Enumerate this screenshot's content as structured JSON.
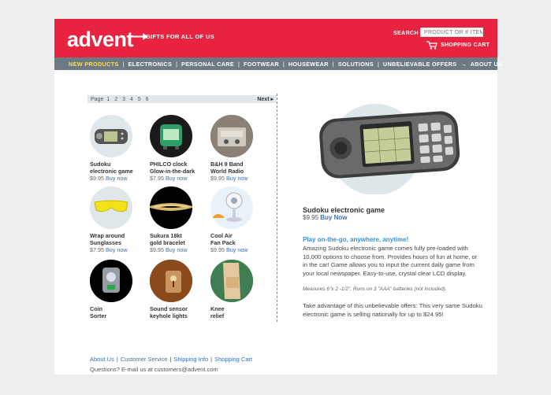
{
  "header": {
    "logo": "advent",
    "tagline": "GIFTS FOR ALL OF US",
    "search_label": "SEARCH",
    "search_placeholder": "PRODUCT OR # ITEM",
    "cart_label": "SHOPPING CART"
  },
  "nav": [
    {
      "label": "NEW PRODUCTS"
    },
    {
      "label": "ELECTRONICS"
    },
    {
      "label": "PERSONAL CARE"
    },
    {
      "label": "FOOTWEAR"
    },
    {
      "label": "HOUSEWEAR"
    },
    {
      "label": "SOLUTIONS"
    },
    {
      "label": "UNBELIEVABLE OFFERS"
    },
    {
      "label": "ABOUT US"
    }
  ],
  "pager": {
    "label": "Page",
    "pages": [
      "1",
      "2",
      "3",
      "4",
      "5",
      "6"
    ],
    "next": "Next ▸"
  },
  "products": [
    {
      "name1": "Sudoku",
      "name2": "electronic game",
      "price": "$9.95",
      "buy": "Buy now"
    },
    {
      "name1": "PHILCO clock",
      "name2": "Glow-in-the-dark",
      "price": "$7.95",
      "buy": "Buy now"
    },
    {
      "name1": "B&H 9 Band",
      "name2": "World Radio",
      "price": "$9.95",
      "buy": "Buy now"
    },
    {
      "name1": "Wrap around",
      "name2": "Sunglasses",
      "price": "$7.95",
      "buy": "Buy now"
    },
    {
      "name1": "Sukura 18kt",
      "name2": "gold bracelet",
      "price": "$9.95",
      "buy": "Buy now"
    },
    {
      "name1": "Cool Air",
      "name2": "Fan Pack",
      "price": "$9.95",
      "buy": "Buy now"
    },
    {
      "name1": "Coin",
      "name2": "Sorter",
      "price": "",
      "buy": ""
    },
    {
      "name1": "Sound sensor",
      "name2": "keyhole lights",
      "price": "",
      "buy": ""
    },
    {
      "name1": "Knee",
      "name2": "relief",
      "price": "",
      "buy": ""
    }
  ],
  "featured": {
    "name": "Sudoku electronic game",
    "price": "$9.95",
    "buy": "Buy Now",
    "promo_title": "Play on-the-go, anywhere, anytime!",
    "promo_body": "Amazing Sudoku electronic game comes fully pre-loaded with 10,000 options to choose from. Provides hours of fun at home, or in the car! Game allows you to input the current daily game from your local newspaper. Easy-to-use, crystal clear LCD display.",
    "promo_note": "Measures 6\"x 2 -1/2\", Runs on 3 \"AAA\" batteries (not included).",
    "offer": "Take advantage of this unbelievable offers: This very same Sudoku electronic game is selling nationally for up to $24.95!"
  },
  "footer": {
    "links": [
      "About Us",
      "Customer Service",
      "Shipping Info",
      "Shopping Cart"
    ],
    "question": "Questions? E-mail us at customers@advent.com"
  },
  "colors": {
    "brand_red": "#e8233f",
    "nav_gray": "#6d7a86",
    "link_blue": "#3b6fb6",
    "active_yellow": "#f4e04d"
  }
}
